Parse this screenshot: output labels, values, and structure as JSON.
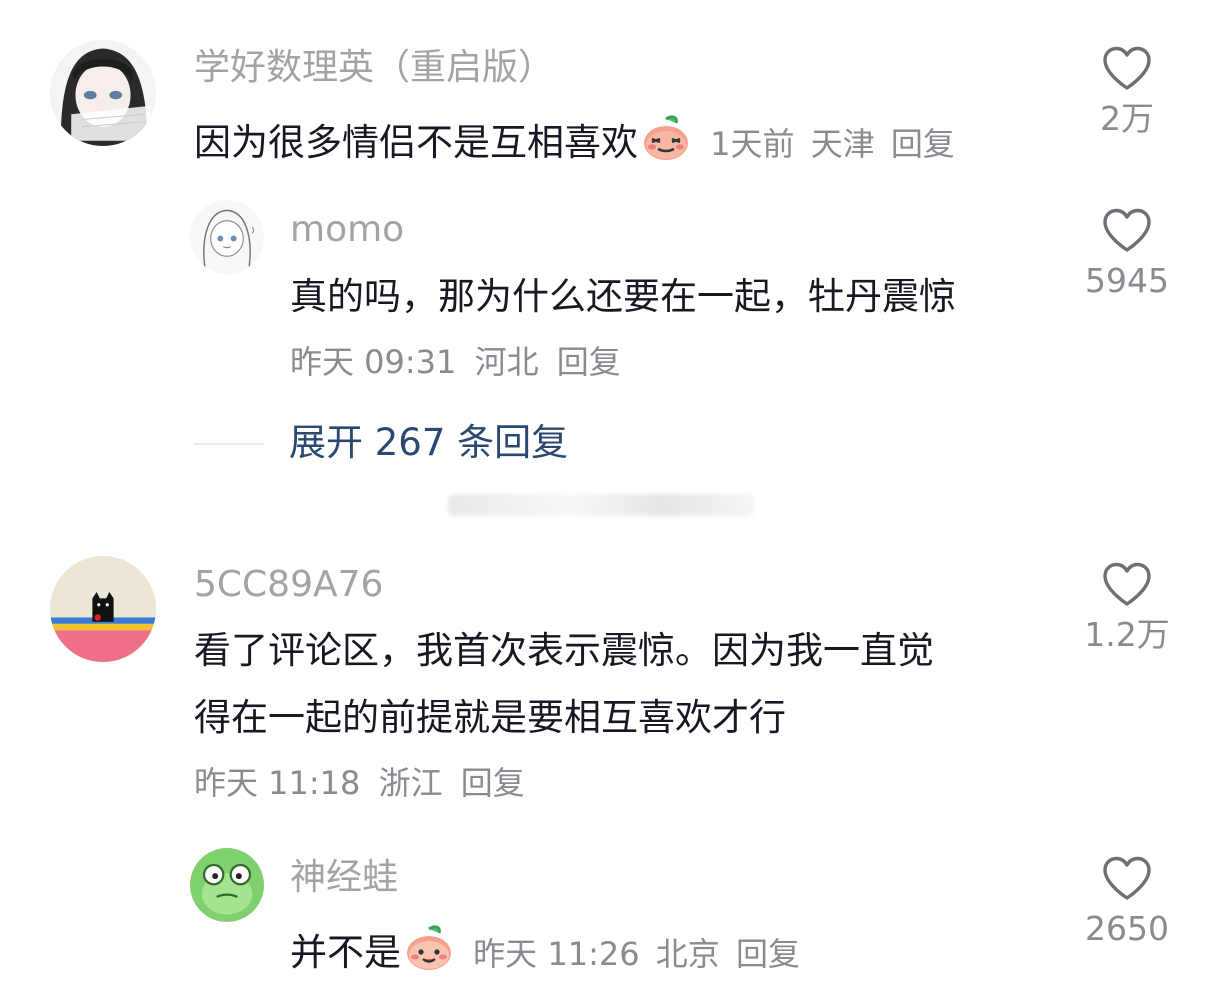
{
  "comments": [
    {
      "username": "学好数理英（重启版）",
      "text": "因为很多情侣不是互相喜欢",
      "time": "1天前",
      "location": "天津",
      "reply": "回复",
      "likes": "2万"
    },
    {
      "username": "momo",
      "text": "真的吗，那为什么还要在一起，牡丹震惊",
      "time": "昨天 09:31",
      "location": "河北",
      "reply": "回复",
      "likes": "5945"
    },
    {
      "username": "5CC89A76",
      "text_line1": "看了评论区，我首次表示震惊。因为我一直觉",
      "text_line2": "得在一起的前提就是要相互喜欢才行",
      "time": "昨天 11:18",
      "location": "浙江",
      "reply": "回复",
      "likes": "1.2万"
    },
    {
      "username": "神经蛙",
      "text": "并不是",
      "time": "昨天 11:26",
      "location": "北京",
      "reply": "回复",
      "likes": "2650"
    }
  ],
  "expand_replies": "展开 267 条回复",
  "icons": {
    "like": "heart-outline-icon",
    "emoji": "peach-face-emoji"
  },
  "colors": {
    "username": "#a3a3a7",
    "text": "#161823",
    "meta": "#8a8b91",
    "expand_link": "#2b4970"
  }
}
